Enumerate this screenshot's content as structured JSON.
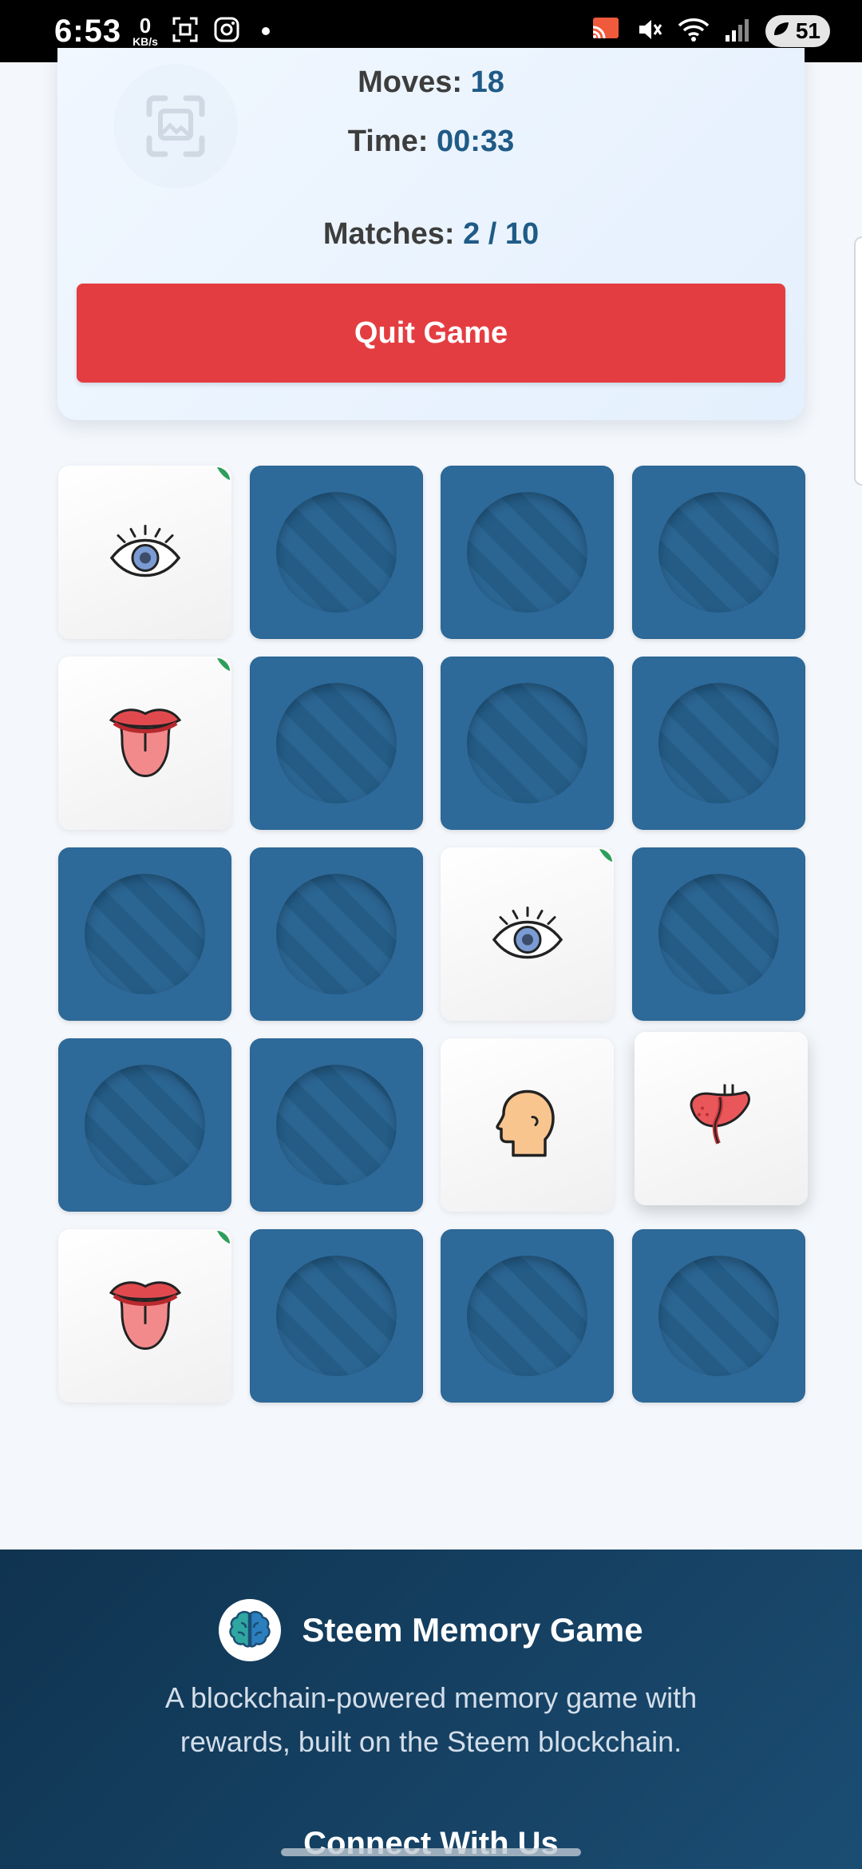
{
  "status_bar": {
    "time": "6:53",
    "net_speed_value": "0",
    "net_speed_unit": "KB/s",
    "battery": "51"
  },
  "stats": {
    "moves_label": "Moves:",
    "moves_value": "18",
    "time_label": "Time:",
    "time_value": "00:33",
    "matches_label": "Matches:",
    "matches_value": "2 / 10",
    "quit_label": "Quit Game"
  },
  "board": {
    "columns": 4,
    "rows": 5,
    "cards": [
      {
        "state": "matched",
        "icon": "eye-icon"
      },
      {
        "state": "hidden"
      },
      {
        "state": "hidden"
      },
      {
        "state": "hidden"
      },
      {
        "state": "matched",
        "icon": "tongue-icon"
      },
      {
        "state": "hidden"
      },
      {
        "state": "hidden"
      },
      {
        "state": "hidden"
      },
      {
        "state": "hidden"
      },
      {
        "state": "hidden"
      },
      {
        "state": "matched",
        "icon": "eye-icon"
      },
      {
        "state": "hidden"
      },
      {
        "state": "hidden"
      },
      {
        "state": "hidden"
      },
      {
        "state": "revealed",
        "icon": "head-icon"
      },
      {
        "state": "revealed",
        "icon": "liver-icon"
      },
      {
        "state": "matched",
        "icon": "tongue-icon"
      },
      {
        "state": "hidden"
      },
      {
        "state": "hidden"
      },
      {
        "state": "hidden"
      }
    ]
  },
  "footer": {
    "title": "Steem Memory Game",
    "description": "A blockchain-powered memory game with rewards, built on the Steem blockchain.",
    "connect_heading": "Connect With Us",
    "logo_icon": "brain-icon"
  },
  "colors": {
    "card_back": "#2d6a9a",
    "quit_button": "#e43d41",
    "stat_value": "#1f5b86",
    "matched_mark": "#2e9e5b",
    "footer_bg": "#143f60"
  }
}
